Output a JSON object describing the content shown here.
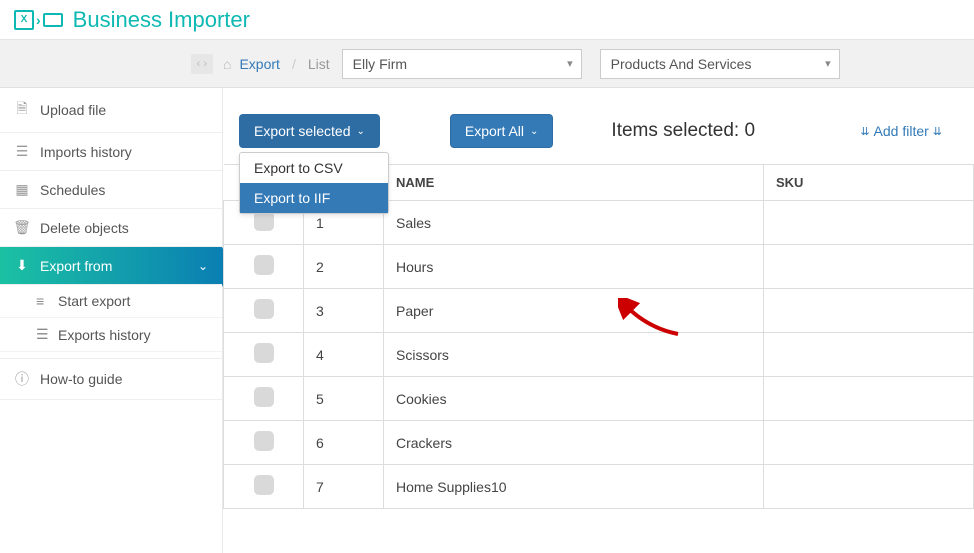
{
  "app": {
    "title": "Business Importer"
  },
  "breadcrumb": {
    "link": "Export",
    "list": "List"
  },
  "selects": {
    "company": "Elly Firm",
    "category": "Products And Services"
  },
  "sidebar": {
    "items": [
      {
        "label": "Upload file"
      },
      {
        "label": "Imports history"
      },
      {
        "label": "Schedules"
      },
      {
        "label": "Delete objects"
      },
      {
        "label": "Export from"
      },
      {
        "label": "How-to guide"
      }
    ],
    "sub": [
      {
        "label": "Start export"
      },
      {
        "label": "Exports history"
      }
    ]
  },
  "toolbar": {
    "export_selected": "Export selected",
    "export_all": "Export All",
    "dropdown": {
      "csv": "Export to CSV",
      "iif": "Export to IIF"
    },
    "status_prefix": "Items selected:",
    "status_count": "0",
    "add_filter": "Add filter"
  },
  "table": {
    "headers": {
      "name": "NAME",
      "sku": "SKU"
    },
    "rows": [
      {
        "num": "1",
        "name": "Sales",
        "sku": ""
      },
      {
        "num": "2",
        "name": "Hours",
        "sku": ""
      },
      {
        "num": "3",
        "name": "Paper",
        "sku": ""
      },
      {
        "num": "4",
        "name": "Scissors",
        "sku": ""
      },
      {
        "num": "5",
        "name": "Cookies",
        "sku": ""
      },
      {
        "num": "6",
        "name": "Crackers",
        "sku": ""
      },
      {
        "num": "7",
        "name": "Home Supplies10",
        "sku": ""
      }
    ]
  }
}
